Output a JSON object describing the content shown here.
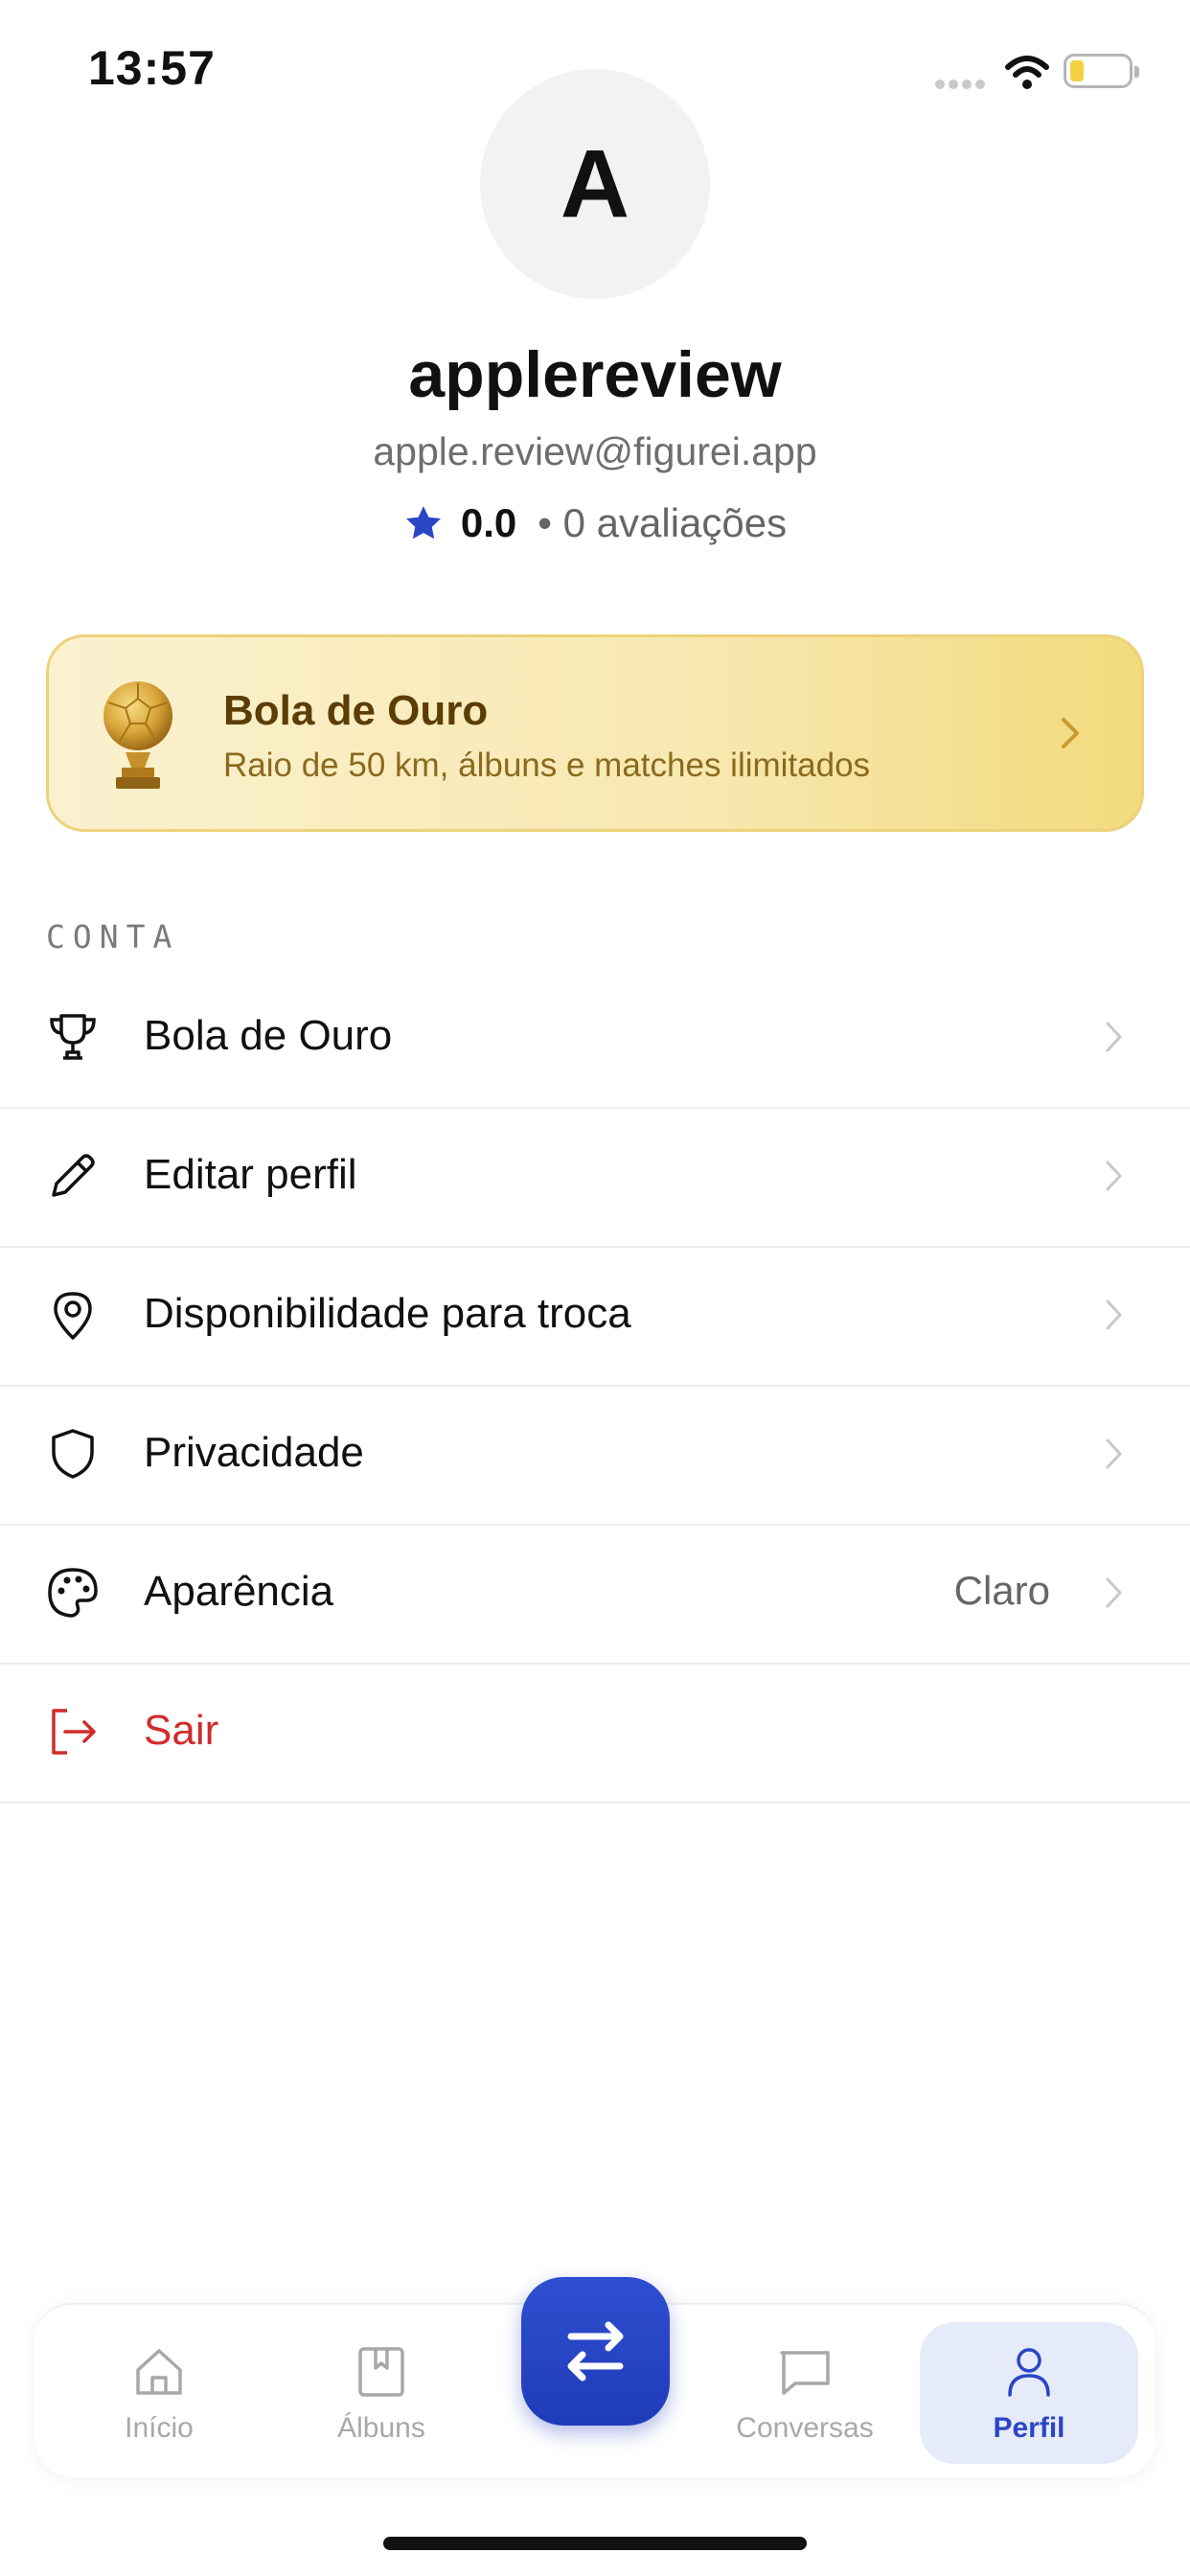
{
  "status_bar": {
    "time": "13:57"
  },
  "profile": {
    "avatar_initial": "A",
    "username": "applereview",
    "email": "apple.review@figurei.app",
    "rating": "0.0",
    "reviews": "• 0 avaliações"
  },
  "banner": {
    "title": "Bola de Ouro",
    "subtitle": "Raio de 50 km, álbuns e matches ilimitados"
  },
  "section": {
    "label": "CONTA"
  },
  "menu": [
    {
      "label": "Bola de Ouro",
      "icon": "trophy-icon"
    },
    {
      "label": "Editar perfil",
      "icon": "pencil-icon"
    },
    {
      "label": "Disponibilidade para troca",
      "icon": "location-pin-icon"
    },
    {
      "label": "Privacidade",
      "icon": "shield-icon"
    },
    {
      "label": "Aparência",
      "icon": "palette-icon",
      "value": "Claro"
    },
    {
      "label": "Sair",
      "icon": "logout-icon"
    }
  ],
  "tabs": [
    {
      "label": "Início",
      "icon": "home-icon"
    },
    {
      "label": "Álbuns",
      "icon": "album-icon"
    },
    {
      "label": "Conversas",
      "icon": "chat-icon"
    },
    {
      "label": "Perfil",
      "icon": "user-icon",
      "active": true
    }
  ],
  "colors": {
    "accent": "#2a46c6",
    "danger": "#d12c2c",
    "gold_border": "#ecd27a",
    "gold_text": "#5c3d05"
  }
}
